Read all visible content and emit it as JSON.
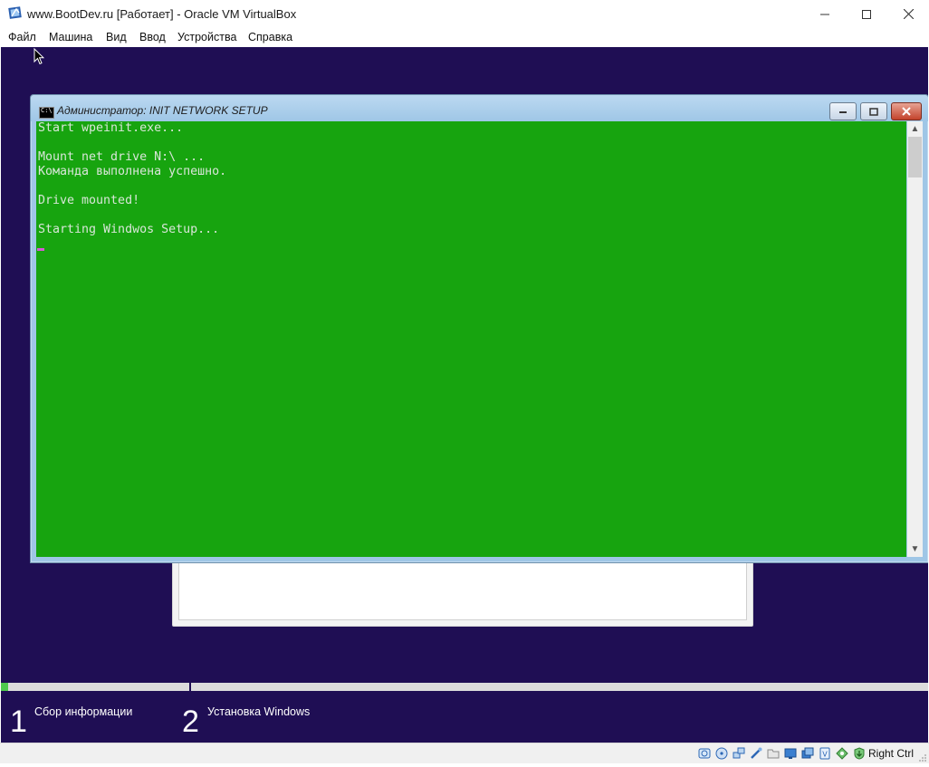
{
  "window": {
    "title": "www.BootDev.ru [Работает] - Oracle VM VirtualBox",
    "app_icon": "virtualbox-icon",
    "controls": [
      "minimize-icon",
      "maximize-icon",
      "close-icon"
    ]
  },
  "menu": {
    "items": [
      "Файл",
      "Машина",
      "Вид",
      "Ввод",
      "Устройства",
      "Справка"
    ]
  },
  "vm": {
    "background_color": "#1f0e54",
    "console": {
      "title": "Администратор:  INIT NETWORK SETUP",
      "icon_text": "C:\\",
      "lines": [
        "Start wpeinit.exe...",
        "",
        "Mount net drive N:\\ ...",
        "Команда выполнена успешно.",
        "",
        "Drive mounted!",
        "",
        "Starting Windwos Setup..."
      ],
      "background_color": "#17a40f",
      "text_color": "#d9e6d9",
      "cursor_color": "#d65ad6"
    },
    "setup": {
      "progress": 0.008,
      "progress_color": "#4ec94e",
      "steps": [
        {
          "number": "1",
          "label": "Сбор информации"
        },
        {
          "number": "2",
          "label": "Установка Windows"
        }
      ]
    }
  },
  "statusbar": {
    "icons": [
      "hard-disk-icon",
      "optical-drive-icon",
      "network-icon",
      "usb-icon",
      "shared-folders-icon",
      "display-icon",
      "video-capture-icon",
      "virtualization-icon",
      "mouse-integration-icon",
      "keyboard-capture-icon"
    ],
    "host_key": "Right Ctrl"
  }
}
